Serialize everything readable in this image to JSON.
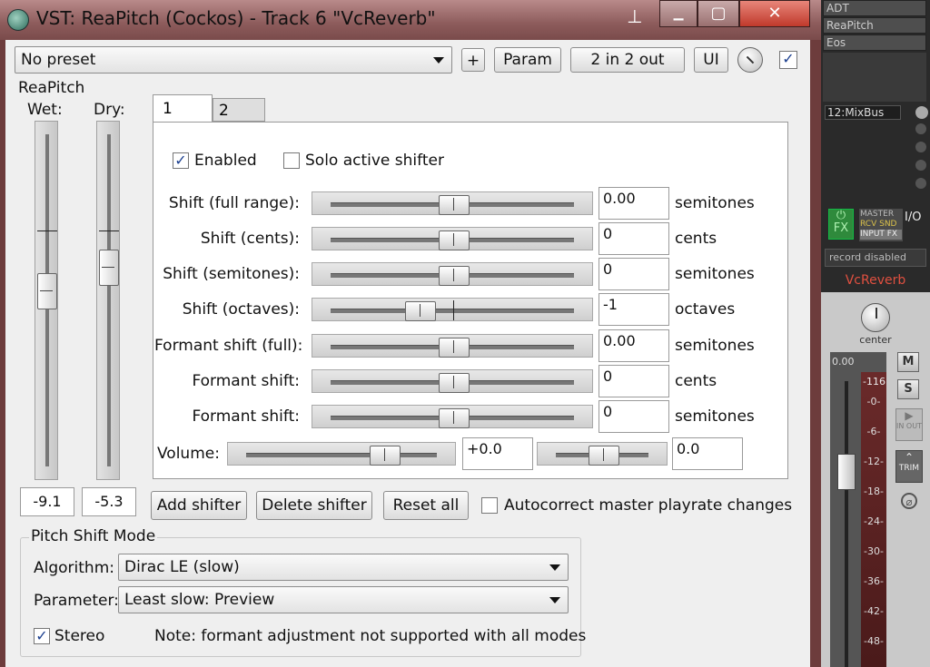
{
  "window": {
    "title": "VST: ReaPitch (Cockos) - Track 6 \"VcReverb\"",
    "controls": {
      "minimize": "▁",
      "maximize": "▢",
      "close": "✕",
      "pin": "📌"
    }
  },
  "toolbar": {
    "preset": "No preset",
    "plus_label": "+",
    "param_label": "Param",
    "io_label": "2 in 2 out",
    "ui_label": "UI",
    "bypass_checked": true
  },
  "plugin": {
    "group_label": "ReaPitch",
    "wet_label": "Wet:",
    "dry_label": "Dry:",
    "wet_value": "-9.1",
    "dry_value": "-5.3"
  },
  "tabs": [
    {
      "label": "1"
    },
    {
      "label": "2"
    }
  ],
  "shifter": {
    "enabled_label": "Enabled",
    "enabled_checked": true,
    "solo_label": "Solo active shifter",
    "solo_checked": false,
    "rows": [
      {
        "label": "Shift (full range):",
        "value": "0.00",
        "unit": "semitones",
        "pos": 0.5
      },
      {
        "label": "Shift (cents):",
        "value": "0",
        "unit": "cents",
        "pos": 0.5
      },
      {
        "label": "Shift (semitones):",
        "value": "0",
        "unit": "semitones",
        "pos": 0.5
      },
      {
        "label": "Shift (octaves):",
        "value": "-1",
        "unit": "octaves",
        "pos": 0.38
      },
      {
        "label": "Formant shift (full):",
        "value": "0.00",
        "unit": "semitones",
        "pos": 0.5
      },
      {
        "label": "Formant shift:",
        "value": "0",
        "unit": "cents",
        "pos": 0.5
      },
      {
        "label": "Formant shift:",
        "value": "0",
        "unit": "semitones",
        "pos": 0.5
      }
    ],
    "volume_label": "Volume:",
    "volume_value": "+0.0",
    "pan_value": "0.0"
  },
  "actions": {
    "add": "Add shifter",
    "delete": "Delete shifter",
    "reset": "Reset all",
    "autocorrect_label": "Autocorrect master playrate changes",
    "autocorrect_checked": false
  },
  "pitch_mode": {
    "group_label": "Pitch Shift Mode",
    "algorithm_label": "Algorithm:",
    "algorithm_value": "Dirac LE (slow)",
    "parameter_label": "Parameter:",
    "parameter_value": "Least slow: Preview",
    "stereo_label": "Stereo",
    "stereo_checked": true,
    "note": "Note: formant adjustment not supported with all modes"
  },
  "mixer": {
    "fx_slots": [
      "ADT",
      "ReaPitch",
      "Eos"
    ],
    "bus_label": "12:MixBus",
    "fx_label": "FX",
    "io_label": "I/O",
    "master_label": "MASTER",
    "rcv_label": "RCV SND",
    "input_fx_label": "INPUT FX",
    "record_label": "record disabled",
    "track_name": "VcReverb",
    "pan_label": "center",
    "volume_readout": "0.00",
    "peak_readout": "-116",
    "m_label": "M",
    "s_label": "S",
    "inout_label": "IN OUT",
    "trim_label": "TRIM",
    "meter_ticks": [
      "-0-",
      "-6-",
      "-12-",
      "-18-",
      "-24-",
      "-30-",
      "-36-",
      "-42-",
      "-48-"
    ]
  }
}
